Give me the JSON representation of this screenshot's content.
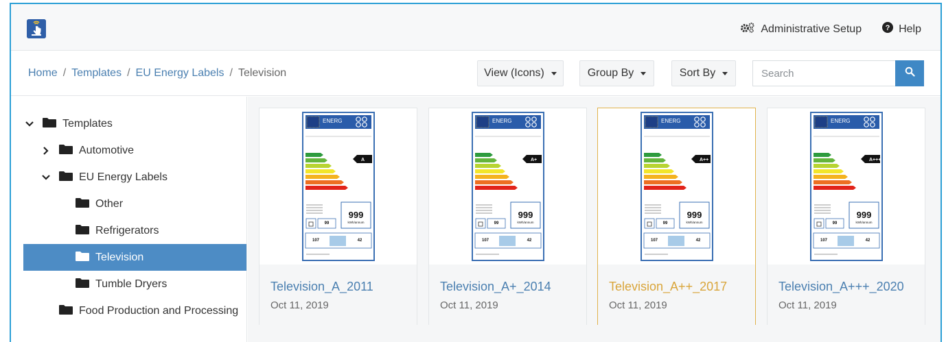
{
  "nav": {
    "admin_label": "Administrative Setup",
    "help_label": "Help"
  },
  "breadcrumb": [
    "Home",
    "Templates",
    "EU Energy Labels",
    "Television"
  ],
  "toolbar": {
    "view_label": "View (Icons)",
    "group_label": "Group By",
    "sort_label": "Sort By",
    "search_placeholder": "Search"
  },
  "tree": {
    "templates": "Templates",
    "automotive": "Automotive",
    "eu_energy_labels": "EU Energy Labels",
    "other": "Other",
    "refrigerators": "Refrigerators",
    "television": "Television",
    "tumble_dryers": "Tumble Dryers",
    "food_production": "Food Production and Processing"
  },
  "cards": [
    {
      "title": "Television_A_2011",
      "date": "Oct 11, 2019",
      "rating": "A",
      "kwh": "999",
      "unit": "kWh/annum",
      "watt": "99",
      "size_cm": "107",
      "size_in": "42",
      "selected": false
    },
    {
      "title": "Television_A+_2014",
      "date": "Oct 11, 2019",
      "rating": "A+",
      "kwh": "999",
      "unit": "kWh/annum",
      "watt": "99",
      "size_cm": "107",
      "size_in": "42",
      "selected": false
    },
    {
      "title": "Television_A++_2017",
      "date": "Oct 11, 2019",
      "rating": "A++",
      "kwh": "999",
      "unit": "kWh/annum",
      "watt": "99",
      "size_cm": "107",
      "size_in": "42",
      "selected": true
    },
    {
      "title": "Television_A+++_2020",
      "date": "Oct 11, 2019",
      "rating": "A+++",
      "kwh": "999",
      "unit": "kWh/annum",
      "watt": "99",
      "size_cm": "107",
      "size_in": "42",
      "selected": false
    }
  ],
  "label_header": "ENERG",
  "colors": {
    "accent": "#4d8cc5",
    "link": "#4a7fb0",
    "selected_border": "#e0b24a",
    "frame_border": "#2a9fd6"
  }
}
